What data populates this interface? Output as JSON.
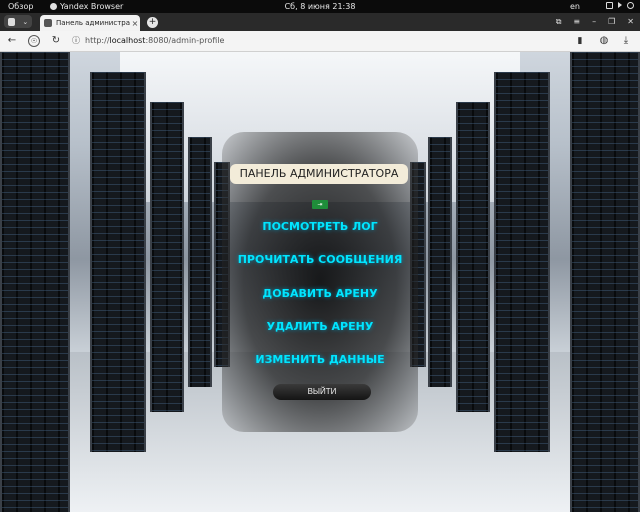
{
  "topbar": {
    "activities": "Обзор",
    "app_name": "Yandex Browser",
    "clock": "Сб, 8 июня  21:38",
    "lang": "en"
  },
  "tabs": [
    {
      "title": "Панель администратора",
      "close": "×"
    }
  ],
  "newtab_label": "+",
  "address": {
    "scheme": "http://",
    "host": "localhost",
    "path": ":8080/admin-profile"
  },
  "page": {
    "panel_title": "ПАНЕЛЬ АДМИНИСТРАТОРА",
    "menu": [
      "ПОСМОТРЕТЬ ЛОГ",
      "ПРОЧИТАТЬ СООБЩЕНИЯ",
      "ДОБАВИТЬ АРЕНУ",
      "УДАЛИТЬ АРЕНУ",
      "ИЗМЕНИТЬ ДАННЫЕ"
    ],
    "logout_label": "ВЫЙТИ"
  },
  "colors": {
    "link": "#00e5ff",
    "title_bg": "#f3ecd9"
  }
}
